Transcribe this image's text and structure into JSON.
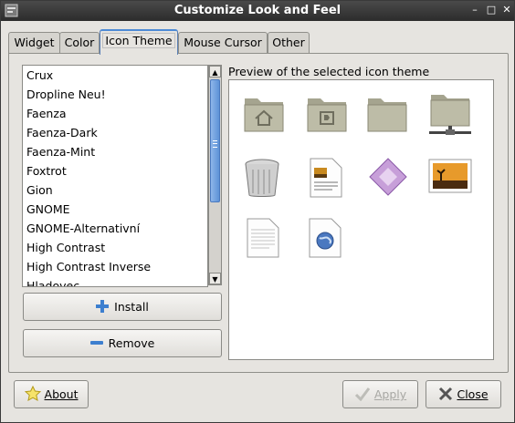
{
  "window": {
    "title": "Customize Look and Feel",
    "controls": [
      "–",
      "□",
      "✕"
    ]
  },
  "tabs": [
    {
      "label": "Widget",
      "active": false
    },
    {
      "label": "Color",
      "active": false
    },
    {
      "label": "Icon Theme",
      "active": true
    },
    {
      "label": "Mouse Cursor",
      "active": false
    },
    {
      "label": "Other",
      "active": false
    }
  ],
  "theme_list": {
    "items": [
      "Crux",
      "Dropline Neu!",
      "Faenza",
      "Faenza-Dark",
      "Faenza-Mint",
      "Foxtrot",
      "Gion",
      "GNOME",
      "GNOME-Alternativní",
      "High Contrast",
      "High Contrast Inverse",
      "Hladovec"
    ]
  },
  "buttons": {
    "install": "Install",
    "remove": "Remove",
    "about": "About",
    "apply": "Apply",
    "close": "Close"
  },
  "preview": {
    "label": "Preview of the selected icon theme",
    "icons": [
      "folder-home-icon",
      "folder-documents-icon",
      "folder-icon",
      "network-folder-icon",
      "trash-icon",
      "image-document-icon",
      "vector-graphic-icon",
      "photo-icon",
      "text-document-icon",
      "web-document-icon"
    ]
  },
  "colors": {
    "accent": "#4d8ad6",
    "folder": "#b9b8a4",
    "install_plus": "#3d7fcf"
  }
}
